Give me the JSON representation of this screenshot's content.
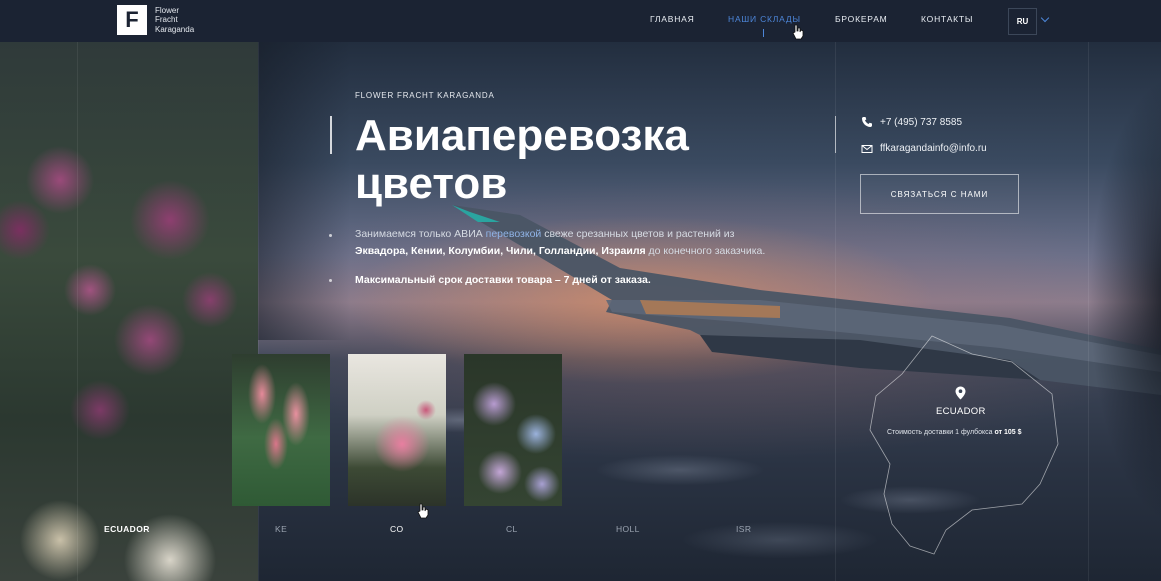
{
  "header": {
    "logo": {
      "mark": "F",
      "lines": [
        "Flower",
        "Fracht",
        "Karaganda"
      ]
    },
    "nav": [
      {
        "label": "ГЛАВНАЯ",
        "active": false
      },
      {
        "label": "НАШИ СКЛАДЫ",
        "active": true
      },
      {
        "label": "БРОКЕРАМ",
        "active": false
      },
      {
        "label": "КОНТАКТЫ",
        "active": false
      }
    ],
    "language": "RU"
  },
  "hero": {
    "kicker": "FLOWER FRACHT KARAGANDA",
    "title_line1": "Авиаперевозка",
    "title_line2": "цветов",
    "desc_part1": "Занимаемся только АВИА ",
    "desc_highlight": "перевозкой",
    "desc_part2": " свеже срезанных цветов и растений из ",
    "desc_countries": "Эквадора, Кении, Колумбии, Чили, Голландии, Израиля",
    "desc_part3": " до конечного заказчика.",
    "note": "Максимальный срок доставки товара – 7 дней от заказа."
  },
  "contacts": {
    "phone": "+7 (495) 737 8585",
    "email": "ffkaragandainfo@info.ru",
    "cta_label": "СВЯЗАТЬСЯ С НАМИ"
  },
  "cards": [
    {
      "name": "calla-lilies"
    },
    {
      "name": "pink-rose"
    },
    {
      "name": "hydrangea"
    }
  ],
  "country_tabs": [
    {
      "label": "ECUADOR",
      "state": "active"
    },
    {
      "label": "KE",
      "state": "normal"
    },
    {
      "label": "CO",
      "state": "current"
    },
    {
      "label": "CL",
      "state": "normal"
    },
    {
      "label": "HOLL",
      "state": "normal"
    },
    {
      "label": "ISR",
      "state": "normal"
    }
  ],
  "map": {
    "country": "ECUADOR",
    "price_prefix": "Стоимость доставки 1 фулбокса ",
    "price_value": "от 105 $"
  },
  "colors": {
    "accent": "#4d86d9",
    "header_bg": "#1b2333"
  },
  "icons": [
    "phone-icon",
    "mail-icon",
    "map-pin-icon",
    "chevron-down-icon",
    "cursor-icon"
  ]
}
